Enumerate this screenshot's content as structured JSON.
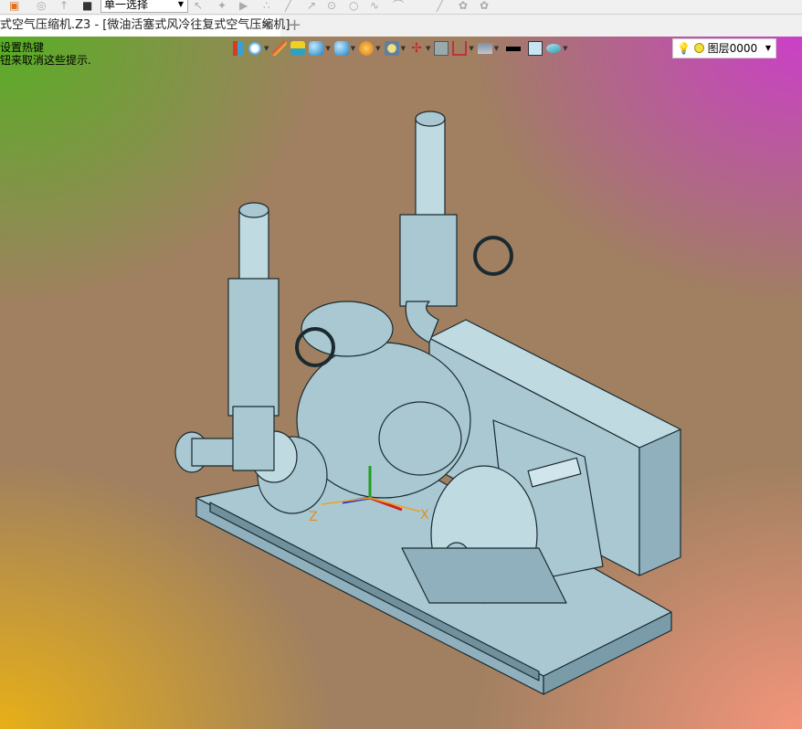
{
  "toolbar": {
    "select_mode": "单一选择"
  },
  "tab": {
    "title": "式空气压缩机.Z3 - [微油活塞式风冷往复式空气压缩机]",
    "close": "✕",
    "new_tab": "+"
  },
  "hint": {
    "line1": "设置热键",
    "line2": "钮来取消这些提示."
  },
  "view_toolbar": {
    "icons": [
      "exit-icon",
      "light-icon",
      "brush-icon",
      "shaded-box-icon",
      "cube-view-icon",
      "display-mode-icon",
      "render-icon",
      "zoom-icon",
      "axis-icon",
      "grid-icon",
      "section-icon",
      "monitor-icon",
      "line-color-icon",
      "fill-color-icon",
      "layer-stack-icon"
    ]
  },
  "layer": {
    "name": "图层0000"
  },
  "axes": {
    "x": "X",
    "z": "Z"
  },
  "colors": {
    "model": "#a9c8d2",
    "edge": "#1a2a30"
  }
}
